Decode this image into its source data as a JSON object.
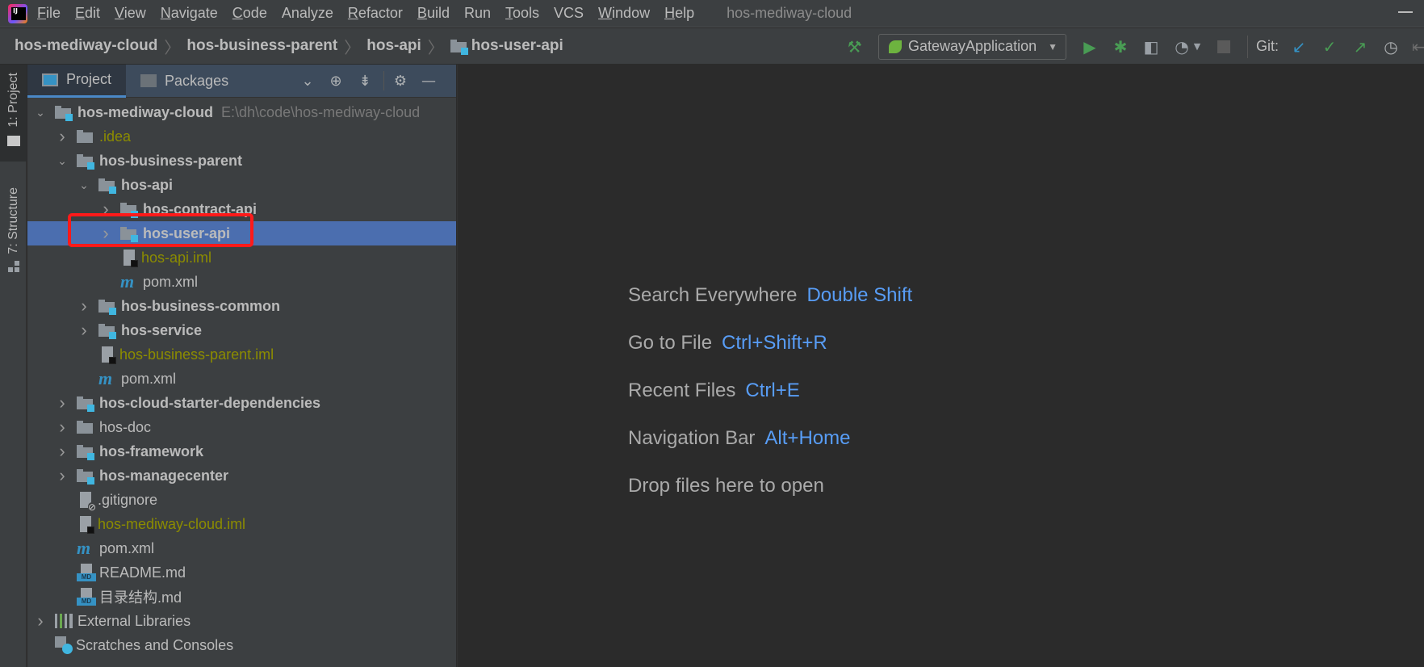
{
  "menubar": {
    "items": [
      {
        "label": "File",
        "mn": "F"
      },
      {
        "label": "Edit",
        "mn": "E"
      },
      {
        "label": "View",
        "mn": "V"
      },
      {
        "label": "Navigate",
        "mn": "N"
      },
      {
        "label": "Code",
        "mn": "C"
      },
      {
        "label": "Analyze",
        "mn": ""
      },
      {
        "label": "Refactor",
        "mn": "R"
      },
      {
        "label": "Build",
        "mn": "B"
      },
      {
        "label": "Run",
        "mn": ""
      },
      {
        "label": "Tools",
        "mn": "T"
      },
      {
        "label": "VCS",
        "mn": ""
      },
      {
        "label": "Window",
        "mn": "W"
      },
      {
        "label": "Help",
        "mn": "H"
      }
    ],
    "window_title": "hos-mediway-cloud"
  },
  "breadcrumb": [
    "hos-mediway-cloud",
    "hos-business-parent",
    "hos-api",
    "hos-user-api"
  ],
  "toolbar": {
    "run_config": "GatewayApplication",
    "git_label": "Git:",
    "colors": {
      "run": "#499c54",
      "update": "#3592c4",
      "commit": "#499c54",
      "push": "#499c54"
    }
  },
  "stripe": {
    "project": "1: Project",
    "structure": "7: Structure"
  },
  "panel": {
    "tabs": [
      {
        "label": "Project",
        "active": true
      },
      {
        "label": "Packages",
        "active": false
      }
    ],
    "tree": [
      {
        "label": "hos-mediway-cloud",
        "path": "E:\\dh\\code\\hos-mediway-cloud",
        "level": 0,
        "arrow": "down",
        "icon": "module-folder",
        "bold": true
      },
      {
        "label": ".idea",
        "level": 1,
        "arrow": "right",
        "icon": "folder",
        "style": "iml"
      },
      {
        "label": "hos-business-parent",
        "level": 1,
        "arrow": "down",
        "icon": "module-folder",
        "bold": true
      },
      {
        "label": "hos-api",
        "level": 2,
        "arrow": "down",
        "icon": "module-folder",
        "bold": true
      },
      {
        "label": "hos-contract-api",
        "level": 3,
        "arrow": "right",
        "icon": "module-folder",
        "bold": true
      },
      {
        "label": "hos-user-api",
        "level": 3,
        "arrow": "right",
        "icon": "module-folder",
        "bold": true,
        "selected": true
      },
      {
        "label": "hos-api.iml",
        "level": 3,
        "icon": "iml-file",
        "style": "iml"
      },
      {
        "label": "pom.xml",
        "level": 3,
        "icon": "maven"
      },
      {
        "label": "hos-business-common",
        "level": 2,
        "arrow": "right",
        "icon": "module-folder",
        "bold": true
      },
      {
        "label": "hos-service",
        "level": 2,
        "arrow": "right",
        "icon": "module-folder",
        "bold": true
      },
      {
        "label": "hos-business-parent.iml",
        "level": 2,
        "icon": "iml-file",
        "style": "iml"
      },
      {
        "label": "pom.xml",
        "level": 2,
        "icon": "maven"
      },
      {
        "label": "hos-cloud-starter-dependencies",
        "level": 1,
        "arrow": "right",
        "icon": "module-folder",
        "bold": true
      },
      {
        "label": "hos-doc",
        "level": 1,
        "arrow": "right",
        "icon": "folder"
      },
      {
        "label": "hos-framework",
        "level": 1,
        "arrow": "right",
        "icon": "module-folder",
        "bold": true
      },
      {
        "label": "hos-managecenter",
        "level": 1,
        "arrow": "right",
        "icon": "module-folder",
        "bold": true
      },
      {
        "label": ".gitignore",
        "level": 1,
        "icon": "gitignore"
      },
      {
        "label": "hos-mediway-cloud.iml",
        "level": 1,
        "icon": "iml-file",
        "style": "iml"
      },
      {
        "label": "pom.xml",
        "level": 1,
        "icon": "maven"
      },
      {
        "label": "README.md",
        "level": 1,
        "icon": "markdown"
      },
      {
        "label": "目录结构.md",
        "level": 1,
        "icon": "markdown"
      },
      {
        "label": "External Libraries",
        "level": 0,
        "arrow": "right",
        "icon": "libraries"
      },
      {
        "label": "Scratches and Consoles",
        "level": 0,
        "icon": "scratches"
      }
    ]
  },
  "editor": {
    "hints": [
      {
        "label": "Search Everywhere",
        "key": "Double Shift"
      },
      {
        "label": "Go to File",
        "key": "Ctrl+Shift+R"
      },
      {
        "label": "Recent Files",
        "key": "Ctrl+E"
      },
      {
        "label": "Navigation Bar",
        "key": "Alt+Home"
      },
      {
        "label": "Drop files here to open",
        "key": ""
      }
    ]
  }
}
